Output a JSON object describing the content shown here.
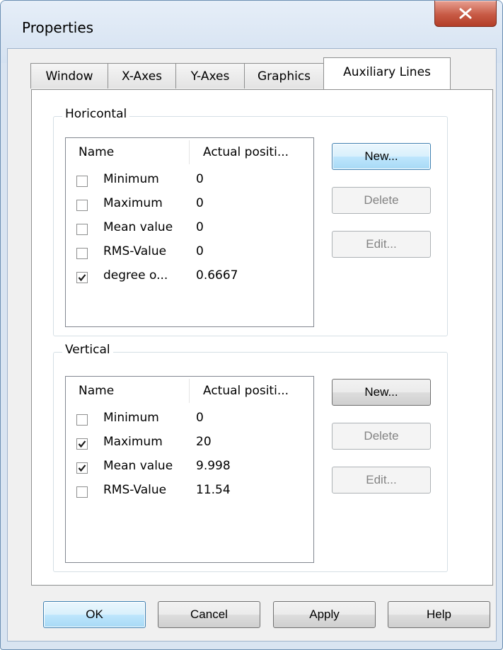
{
  "window": {
    "title": "Properties"
  },
  "tabs": [
    "Window",
    "X-Axes",
    "Y-Axes",
    "Graphics",
    "Auxiliary Lines"
  ],
  "active_tab": "Auxiliary Lines",
  "horizontal": {
    "label": "Horicontal",
    "col_name": "Name",
    "col_position": "Actual positi...",
    "rows": [
      {
        "name": "Minimum",
        "value": "0",
        "checked": false
      },
      {
        "name": "Maximum",
        "value": "0",
        "checked": false
      },
      {
        "name": "Mean value",
        "value": "0",
        "checked": false
      },
      {
        "name": "RMS-Value",
        "value": "0",
        "checked": false
      },
      {
        "name": "degree o...",
        "value": "0.6667",
        "checked": true
      }
    ],
    "new_label": "New...",
    "delete_label": "Delete",
    "edit_label": "Edit..."
  },
  "vertical": {
    "label": "Vertical",
    "col_name": "Name",
    "col_position": "Actual positi...",
    "rows": [
      {
        "name": "Minimum",
        "value": "0",
        "checked": false
      },
      {
        "name": "Maximum",
        "value": "20",
        "checked": true
      },
      {
        "name": "Mean value",
        "value": "9.998",
        "checked": true
      },
      {
        "name": "RMS-Value",
        "value": "11.54",
        "checked": false
      }
    ],
    "new_label": "New...",
    "delete_label": "Delete",
    "edit_label": "Edit..."
  },
  "footer": {
    "ok": "OK",
    "cancel": "Cancel",
    "apply": "Apply",
    "help": "Help"
  },
  "icons": {
    "close": "close-icon",
    "check": "checkmark-icon"
  }
}
